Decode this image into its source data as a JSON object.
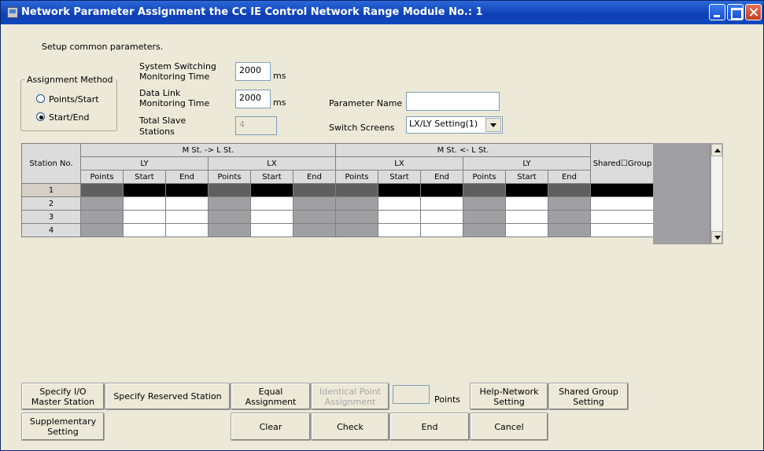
{
  "title": "Network Parameter  Assignment the CC IE Control Network Range Module No.: 1",
  "intro": "Setup common parameters.",
  "assignment_method": {
    "title": "Assignment Method",
    "options": [
      "Points/Start",
      "Start/End"
    ],
    "selected": "Start/End"
  },
  "system_switching": {
    "label1": "System Switching",
    "label2": "Monitoring Time",
    "value": "2000",
    "unit": "ms"
  },
  "data_link": {
    "label1": "Data Link",
    "label2": "Monitoring Time",
    "value": "2000",
    "unit": "ms"
  },
  "total_slave": {
    "label1": "Total Slave",
    "label2": "Stations",
    "value": "4"
  },
  "parameter_name": {
    "label": "Parameter Name",
    "value": ""
  },
  "switch_screens": {
    "label": "Switch Screens",
    "value": "LX/LY Setting(1)"
  },
  "table": {
    "station_no": "Station No.",
    "group_a": "M St. -> L St.",
    "group_b": "M St. <- L St.",
    "sub_ly": "LY",
    "sub_lx": "LX",
    "col_points": "Points",
    "col_start": "Start",
    "col_end": "End",
    "shared_group": "Shared☐Group",
    "rows": [
      "1",
      "2",
      "3",
      "4"
    ]
  },
  "buttons": {
    "specify_io": "Specify I/O\nMaster Station",
    "specify_reserved": "Specify Reserved Station",
    "equal": "Equal\nAssignment",
    "identical": "Identical Point\nAssignment",
    "points": "Points",
    "help_network": "Help-Network\nSetting",
    "shared_group": "Shared Group\nSetting",
    "supplementary": "Supplementary\nSetting",
    "clear": "Clear",
    "check": "Check",
    "end": "End",
    "cancel": "Cancel"
  }
}
